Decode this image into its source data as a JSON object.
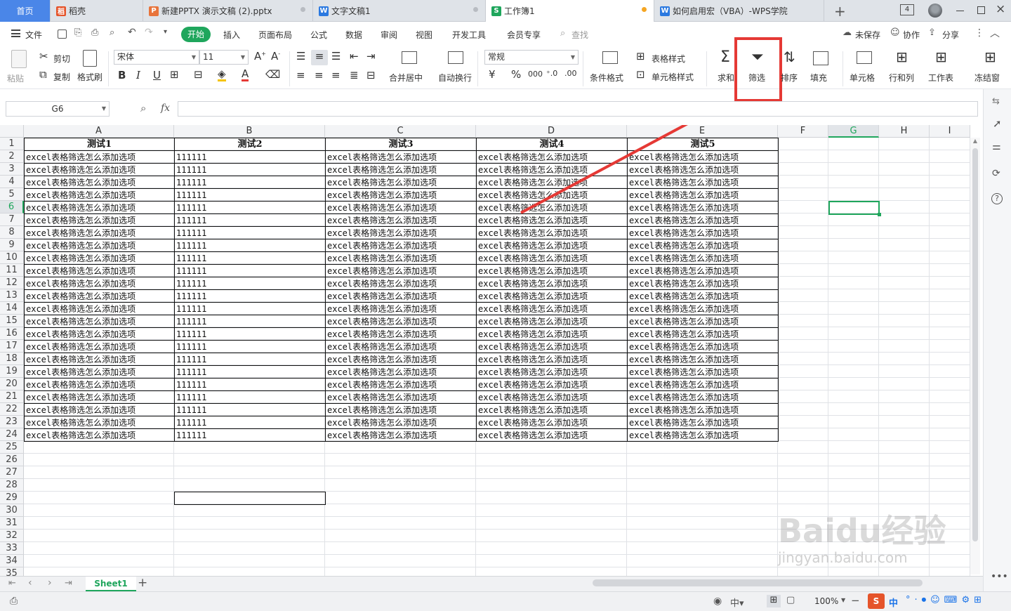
{
  "tabs": [
    {
      "label": "首页",
      "icon": "",
      "active": false
    },
    {
      "label": "稻壳",
      "icon": "稻",
      "icon_color": "#e5542a"
    },
    {
      "label": "新建PPTX 演示文稿 (2).pptx",
      "icon": "P",
      "icon_color": "#e8743b"
    },
    {
      "label": "文字文稿1",
      "icon": "W",
      "icon_color": "#2b79e0"
    },
    {
      "label": "工作簿1",
      "icon": "S",
      "icon_color": "#1fa65c"
    },
    {
      "label": "如何启用宏（VBA）-WPS学院",
      "icon": "W",
      "icon_color": "#2b79e0"
    }
  ],
  "tabbar": {
    "add": "+",
    "page_count": "4"
  },
  "menu": {
    "file": "文件",
    "items": [
      "开始",
      "插入",
      "页面布局",
      "公式",
      "数据",
      "审阅",
      "视图",
      "开发工具",
      "会员专享"
    ],
    "search": "查找",
    "unsaved": "未保存",
    "collab": "协作",
    "share": "分享"
  },
  "ribbon": {
    "paste": "粘贴",
    "cut": "剪切",
    "copy": "复制",
    "format_painter": "格式刷",
    "font_name": "宋体",
    "font_size": "11",
    "merge_center": "合并居中",
    "wrap_text": "自动换行",
    "number_format": "常规",
    "conditional_format": "条件格式",
    "table_style": "表格样式",
    "cell_style": "单元格样式",
    "sum": "求和",
    "filter": "筛选",
    "sort": "排序",
    "fill": "填充",
    "cell": "单元格",
    "row_col": "行和列",
    "worksheet": "工作表",
    "freeze": "冻结窗"
  },
  "formula_bar": {
    "name_box": "G6",
    "fx": "fx",
    "formula": ""
  },
  "columns": [
    "A",
    "B",
    "C",
    "D",
    "E",
    "F",
    "G",
    "H",
    "I"
  ],
  "rows": [
    "1",
    "2",
    "3",
    "4",
    "5",
    "6",
    "7",
    "8",
    "9",
    "10",
    "11",
    "12",
    "13",
    "14",
    "15",
    "16",
    "17",
    "18",
    "19",
    "20",
    "21",
    "22",
    "23",
    "24",
    "25",
    "26",
    "27",
    "28",
    "29",
    "30",
    "31",
    "32",
    "33",
    "34",
    "35"
  ],
  "table": {
    "headers": [
      "测试1",
      "测试2",
      "测试3",
      "测试4",
      "测试5"
    ],
    "row_text": "excel表格筛选怎么添加选项",
    "col_b_value": "111111",
    "data_row_count": 23
  },
  "sheet_tabs": [
    "Sheet1"
  ],
  "status": {
    "zoom": "100%",
    "ime": "中"
  },
  "watermark": {
    "text": "Baidu经验",
    "url": "jingyan.baidu.com"
  },
  "colors": {
    "accent_green": "#1fa65c",
    "highlight_red": "#e53935",
    "active_tab_bg": "#ffffff"
  }
}
